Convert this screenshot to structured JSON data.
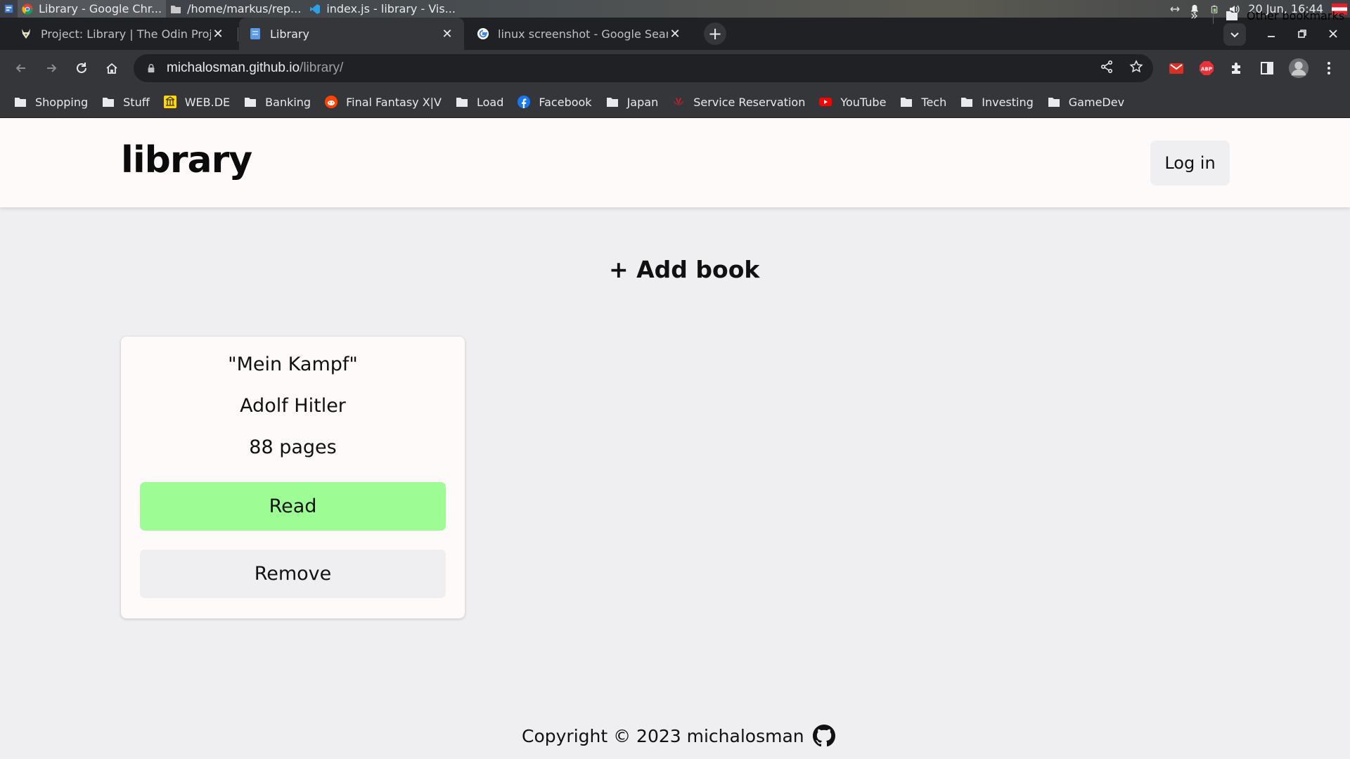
{
  "taskbar": {
    "tasks": [
      {
        "label": "Library - Google Chr...",
        "icon": "chrome-icon"
      },
      {
        "label": "/home/markus/rep...",
        "icon": "folder-icon"
      },
      {
        "label": "index.js - library - Vis...",
        "icon": "vscode-icon"
      }
    ],
    "datetime": "20 Jun, 16:44"
  },
  "tabs": [
    {
      "title": "Project: Library | The Odin Proj",
      "icon": "odin-icon"
    },
    {
      "title": "Library",
      "icon": "document-icon"
    },
    {
      "title": "linux screenshot - Google Searc",
      "icon": "google-icon"
    }
  ],
  "toolbar": {
    "url_host": "michalosman.github.io",
    "url_path": "/library/"
  },
  "bookmarks": [
    {
      "label": "Shopping",
      "icon": "folder-icon"
    },
    {
      "label": "Stuff",
      "icon": "folder-icon"
    },
    {
      "label": "WEB.DE",
      "icon": "webde-icon"
    },
    {
      "label": "Banking",
      "icon": "folder-icon"
    },
    {
      "label": "Final Fantasy X|V",
      "icon": "reddit-icon"
    },
    {
      "label": "Load",
      "icon": "folder-icon"
    },
    {
      "label": "Facebook",
      "icon": "facebook-icon"
    },
    {
      "label": "Japan",
      "icon": "folder-icon"
    },
    {
      "label": "Service Reservation",
      "icon": "huawei-icon"
    },
    {
      "label": "YouTube",
      "icon": "youtube-icon"
    },
    {
      "label": "Tech",
      "icon": "folder-icon"
    },
    {
      "label": "Investing",
      "icon": "folder-icon"
    },
    {
      "label": "GameDev",
      "icon": "folder-icon"
    }
  ],
  "bookmarks_more": "»",
  "other_bookmarks": "Other bookmarks",
  "page": {
    "logo": "library",
    "login_label": "Log in",
    "add_book_label": "+ Add book",
    "book": {
      "title": "\"Mein Kampf\"",
      "author": "Adolf Hitler",
      "pages": "88 pages",
      "read_label": "Read",
      "remove_label": "Remove"
    },
    "footer": "Copyright © 2023 michalosman"
  },
  "colors": {
    "read_button": "#9efc95",
    "page_bg": "#efeff1",
    "header_bg": "#fdfaf9"
  }
}
